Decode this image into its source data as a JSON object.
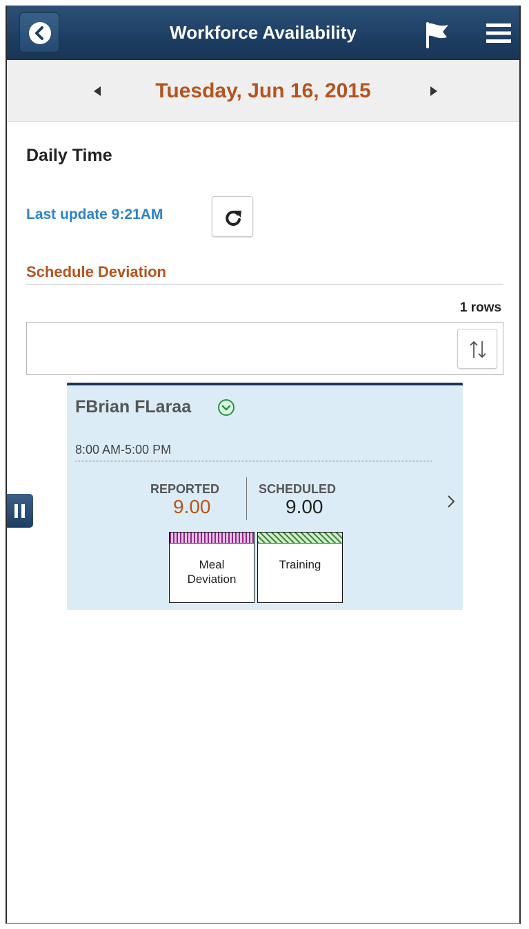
{
  "header": {
    "title": "Workforce Availability",
    "back_icon": "back-icon",
    "flag_icon": "flag-icon",
    "menu_icon": "hamburger-menu-icon",
    "bar_color": "#1d3e63"
  },
  "date_nav": {
    "date": "Tuesday, Jun 16, 2015",
    "prev_icon": "caret-left-icon",
    "next_icon": "caret-right-icon",
    "date_color": "#b5541e"
  },
  "page": {
    "section_title": "Daily Time",
    "last_update": "Last update 9:21AM",
    "refresh_icon": "refresh-icon"
  },
  "grid": {
    "title": "Schedule Deviation",
    "rows_count": "1 rows",
    "sort_icon": "sort-icon"
  },
  "card": {
    "employee_name": "FBrian FLaraa",
    "shift": "8:00 AM-5:00 PM",
    "reported_label": "REPORTED",
    "reported_value": "9.00",
    "scheduled_label": "SCHEDULED",
    "scheduled_value": "9.00",
    "reported_color": "#b5541e",
    "tiles": [
      {
        "line1": "Meal",
        "line2": "Deviation",
        "color": "#8a2a86"
      },
      {
        "line1": "Training",
        "line2": "",
        "color": "#3a8a34"
      }
    ]
  }
}
